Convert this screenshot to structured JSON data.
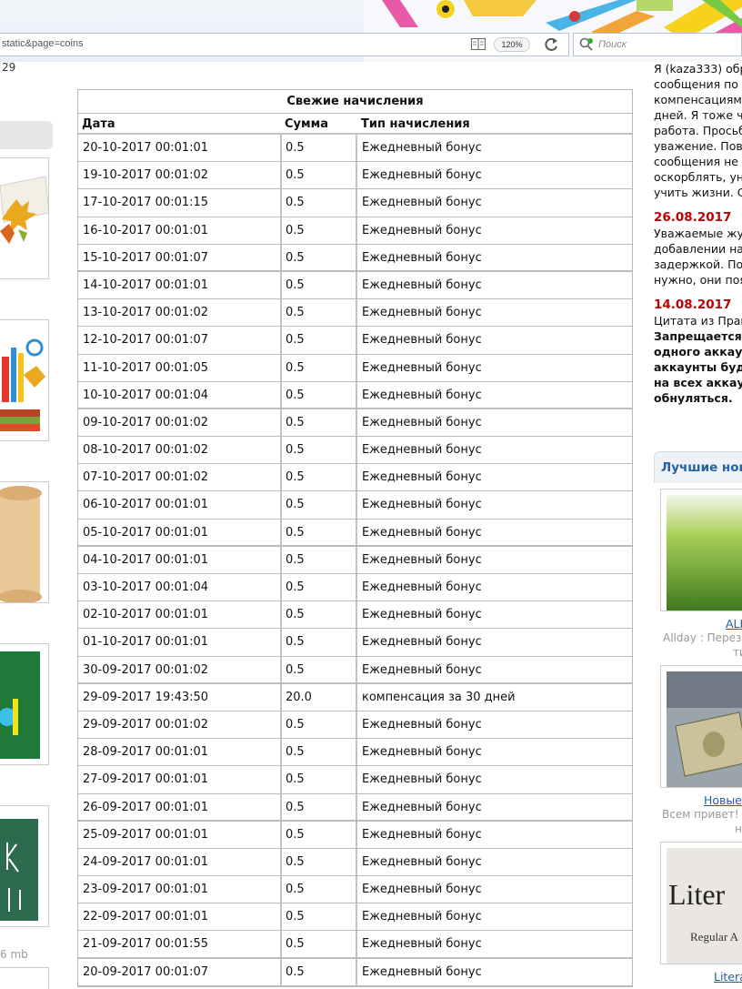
{
  "browser": {
    "url_fragment": "static&page=coins",
    "zoom": "120%",
    "search_placeholder": "Поиск"
  },
  "left_column": {
    "top_number": "29",
    "bottom_size": "6 mb"
  },
  "accruals": {
    "title": "Свежие начисления",
    "columns": [
      "Дата",
      "Сумма",
      "Тип начисления"
    ],
    "rows": [
      {
        "date": "20-10-2017 00:01:01",
        "amount": "0.5",
        "type": "Ежедневный бонус"
      },
      {
        "date": "19-10-2017 00:01:02",
        "amount": "0.5",
        "type": "Ежедневный бонус"
      },
      {
        "date": "17-10-2017 00:01:15",
        "amount": "0.5",
        "type": "Ежедневный бонус"
      },
      {
        "date": "16-10-2017 00:01:01",
        "amount": "0.5",
        "type": "Ежедневный бонус"
      },
      {
        "date": "15-10-2017 00:01:07",
        "amount": "0.5",
        "type": "Ежедневный бонус"
      },
      {
        "date": "14-10-2017 00:01:01",
        "amount": "0.5",
        "type": "Ежедневный бонус"
      },
      {
        "date": "13-10-2017 00:01:02",
        "amount": "0.5",
        "type": "Ежедневный бонус"
      },
      {
        "date": "12-10-2017 00:01:07",
        "amount": "0.5",
        "type": "Ежедневный бонус"
      },
      {
        "date": "11-10-2017 00:01:05",
        "amount": "0.5",
        "type": "Ежедневный бонус"
      },
      {
        "date": "10-10-2017 00:01:04",
        "amount": "0.5",
        "type": "Ежедневный бонус"
      },
      {
        "date": "09-10-2017 00:01:02",
        "amount": "0.5",
        "type": "Ежедневный бонус"
      },
      {
        "date": "08-10-2017 00:01:02",
        "amount": "0.5",
        "type": "Ежедневный бонус"
      },
      {
        "date": "07-10-2017 00:01:02",
        "amount": "0.5",
        "type": "Ежедневный бонус"
      },
      {
        "date": "06-10-2017 00:01:01",
        "amount": "0.5",
        "type": "Ежедневный бонус"
      },
      {
        "date": "05-10-2017 00:01:01",
        "amount": "0.5",
        "type": "Ежедневный бонус"
      },
      {
        "date": "04-10-2017 00:01:01",
        "amount": "0.5",
        "type": "Ежедневный бонус"
      },
      {
        "date": "03-10-2017 00:01:04",
        "amount": "0.5",
        "type": "Ежедневный бонус"
      },
      {
        "date": "02-10-2017 00:01:01",
        "amount": "0.5",
        "type": "Ежедневный бонус"
      },
      {
        "date": "01-10-2017 00:01:01",
        "amount": "0.5",
        "type": "Ежедневный бонус"
      },
      {
        "date": "30-09-2017 00:01:02",
        "amount": "0.5",
        "type": "Ежедневный бонус"
      },
      {
        "date": "29-09-2017 19:43:50",
        "amount": "20.0",
        "type": "компенсация за 30 дней"
      },
      {
        "date": "29-09-2017 00:01:02",
        "amount": "0.5",
        "type": "Ежедневный бонус"
      },
      {
        "date": "28-09-2017 00:01:01",
        "amount": "0.5",
        "type": "Ежедневный бонус"
      },
      {
        "date": "27-09-2017 00:01:01",
        "amount": "0.5",
        "type": "Ежедневный бонус"
      },
      {
        "date": "26-09-2017 00:01:01",
        "amount": "0.5",
        "type": "Ежедневный бонус"
      },
      {
        "date": "25-09-2017 00:01:01",
        "amount": "0.5",
        "type": "Ежедневный бонус"
      },
      {
        "date": "24-09-2017 00:01:01",
        "amount": "0.5",
        "type": "Ежедневный бонус"
      },
      {
        "date": "23-09-2017 00:01:01",
        "amount": "0.5",
        "type": "Ежедневный бонус"
      },
      {
        "date": "22-09-2017 00:01:01",
        "amount": "0.5",
        "type": "Ежедневный бонус"
      },
      {
        "date": "21-09-2017 00:01:55",
        "amount": "0.5",
        "type": "Ежедневный бонус"
      },
      {
        "date": "20-09-2017 00:01:07",
        "amount": "0.5",
        "type": "Ежедневный бонус"
      }
    ]
  },
  "news": {
    "intro_lines": [
      "Я (kaza333) обр",
      "сообщения по",
      "компенсациям",
      "дней. Я тоже ч",
      "работа. Просьб",
      "уважение. Повт",
      "сообщения не",
      "оскорблять, ун",
      "учить жизни. С"
    ],
    "items": [
      {
        "date": "26.08.2017",
        "lines": [
          "Уважаемые жур",
          "добавлении на",
          "задержкой. По",
          "нужно, они поя"
        ]
      },
      {
        "date": "14.08.2017",
        "lines": [
          "Цитата из Прав"
        ],
        "bold_lines": [
          "Запрещается",
          "одного аккау",
          "аккаунты буд",
          "на всех аккау",
          "обнуляться."
        ]
      }
    ],
    "best_news_title": "Лучшие нов",
    "cards": [
      {
        "link": "ALL",
        "desc_lines": [
          "Allday : Переза",
          "ти"
        ]
      },
      {
        "link": "Новые",
        "desc_lines": [
          "Всем привет! Д",
          "н"
        ]
      },
      {
        "link": "Litera",
        "thumb_text": "Liter",
        "thumb_sub": "Regular A"
      }
    ]
  }
}
